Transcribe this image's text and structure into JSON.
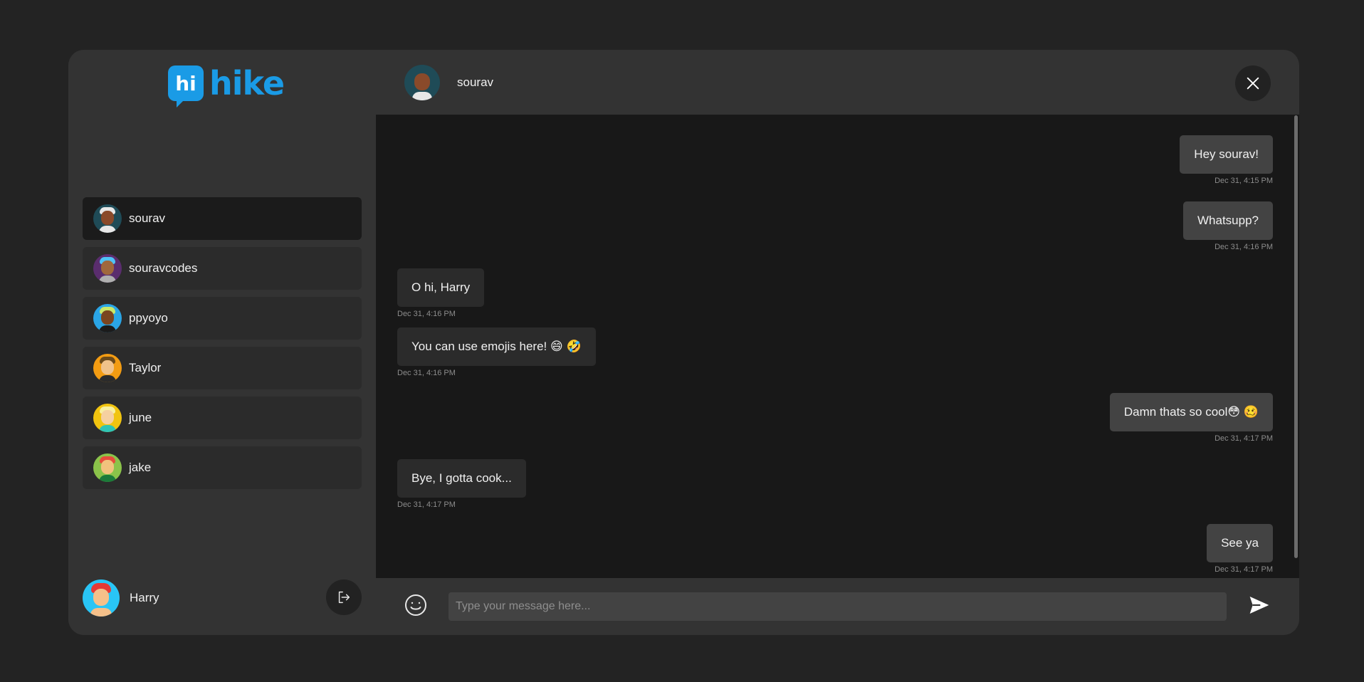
{
  "brand": {
    "logo_badge": "hi",
    "logo_text": "hike",
    "color": "#1a9be6"
  },
  "contacts": [
    {
      "name": "sourav",
      "active": true
    },
    {
      "name": "souravcodes",
      "active": false
    },
    {
      "name": "ppyoyo",
      "active": false
    },
    {
      "name": "Taylor",
      "active": false
    },
    {
      "name": "june",
      "active": false
    },
    {
      "name": "jake",
      "active": false
    }
  ],
  "current_user": {
    "name": "Harry"
  },
  "chat": {
    "contact_name": "sourav",
    "messages": [
      {
        "direction": "out",
        "text": "Hey sourav!",
        "time": "Dec 31, 4:15 PM"
      },
      {
        "direction": "out",
        "text": "Whatsupp?",
        "time": "Dec 31, 4:16 PM"
      },
      {
        "direction": "in",
        "text": "O hi, Harry",
        "time": "Dec 31, 4:16 PM"
      },
      {
        "direction": "in",
        "text": "You can use emojis here! 😄 🤣",
        "time": "Dec 31, 4:16 PM"
      },
      {
        "direction": "out",
        "text": "Damn thats so cool😳 🥴",
        "time": "Dec 31, 4:17 PM"
      },
      {
        "direction": "in",
        "text": "Bye, I gotta cook...",
        "time": "Dec 31, 4:17 PM"
      },
      {
        "direction": "out",
        "text": "See ya",
        "time": "Dec 31, 4:17 PM"
      }
    ]
  },
  "composer": {
    "placeholder": "Type your message here...",
    "value": ""
  },
  "colors": {
    "page_bg": "#232323",
    "panel_bg": "#333333",
    "chat_bg": "#181818",
    "bubble_out": "#434343",
    "bubble_in": "#2b2b2b"
  }
}
